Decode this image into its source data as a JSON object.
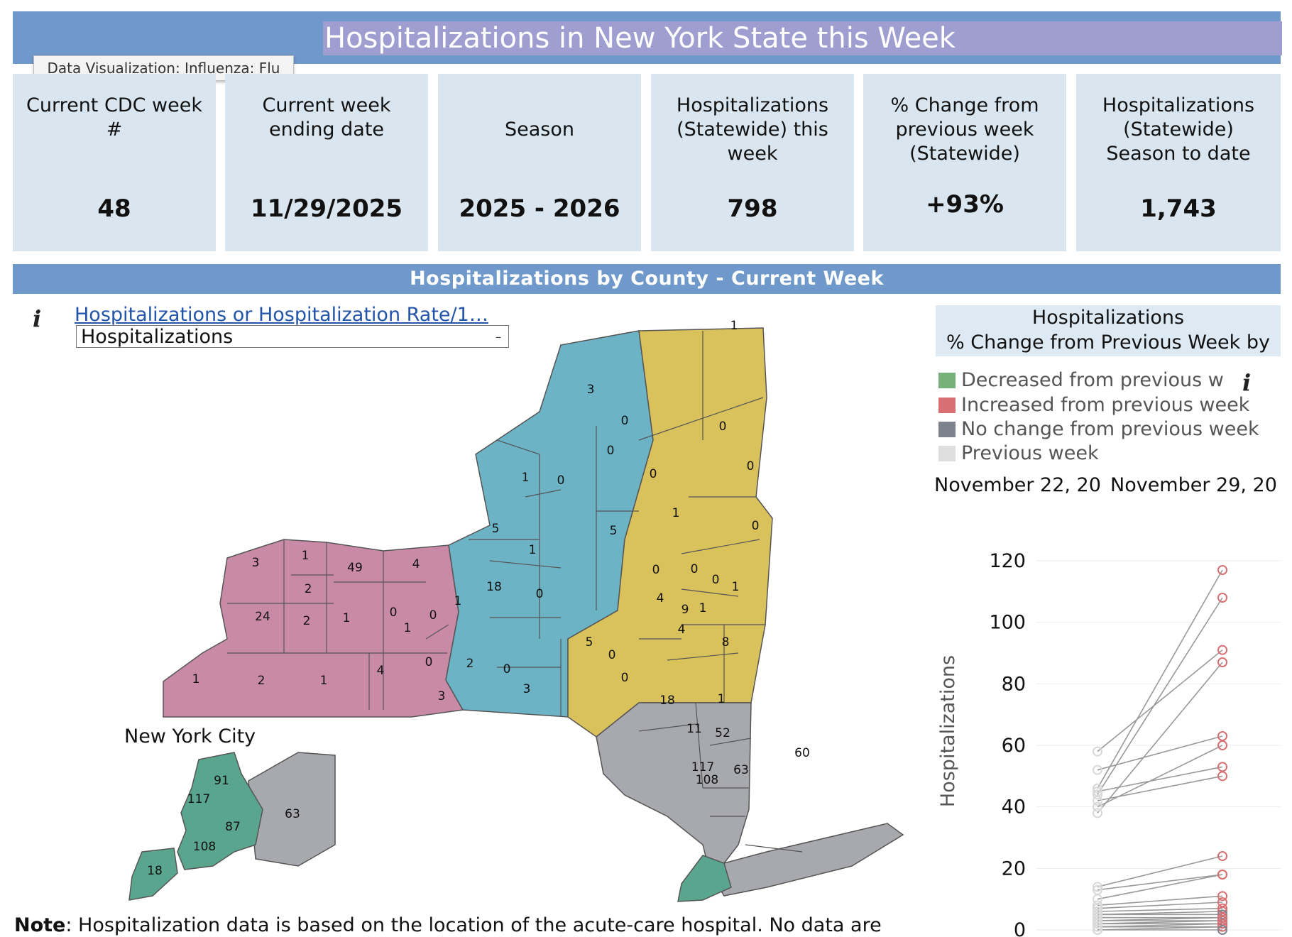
{
  "header": {
    "title": "Hospitalizations in New York State this Week",
    "tooltip": "Data Visualization: Influenza: Flu"
  },
  "cards": [
    {
      "label": "Current CDC week\n#",
      "value": "48"
    },
    {
      "label": "Current week\nending date",
      "value": "11/29/2025"
    },
    {
      "label": "Season",
      "value": "2025 - 2026"
    },
    {
      "label": "Hospitalizations\n(Statewide) this\nweek",
      "value": "798"
    },
    {
      "label": "% Change from\nprevious week\n(Statewide)",
      "value": "+93%"
    },
    {
      "label": "Hospitalizations\n(Statewide)\nSeason to date",
      "value": "1,743"
    }
  ],
  "section_title": "Hospitalizations by County - Current Week",
  "measure_selector": {
    "label": "Hospitalizations or Hospitalization Rate/1…",
    "selected": "Hospitalizations",
    "arrow": "–"
  },
  "map": {
    "nyc_label": "New York City",
    "colors": {
      "western": "#c98aa8",
      "central": "#6cb3c5",
      "eastern": "#d9c25c",
      "downstate": "#a8a9ae",
      "nyc": "#5aa58e"
    },
    "county_values": [
      "3",
      "1",
      "49",
      "4",
      "2",
      "24",
      "2",
      "1",
      "0",
      "0",
      "1",
      "1",
      "2",
      "1",
      "4",
      "0",
      "3",
      "2",
      "1",
      "18",
      "0",
      "0",
      "3",
      "1",
      "5",
      "1",
      "0",
      "3",
      "0",
      "5",
      "0",
      "0",
      "1",
      "0",
      "1",
      "0",
      "0",
      "0",
      "4",
      "5",
      "9",
      "0",
      "1",
      "0",
      "0",
      "1",
      "8",
      "4",
      "0",
      "18",
      "1",
      "11",
      "52",
      "117",
      "108",
      "63",
      "60"
    ],
    "nyc_values": [
      "91",
      "117",
      "87",
      "108",
      "18",
      "63"
    ]
  },
  "legend": {
    "title_line1": "Hospitalizations",
    "title_line2": "% Change from Previous Week by",
    "items": [
      {
        "label": "Decreased from previous w",
        "color": "#78b07a"
      },
      {
        "label": "Increased from previous week",
        "color": "#d86f72"
      },
      {
        "label": "No change from previous week",
        "color": "#7c838c"
      },
      {
        "label": "Previous week",
        "color": "#dedede"
      }
    ]
  },
  "chart_data": {
    "type": "scatter",
    "categories": [
      "November 22, 20",
      "November 29, 20"
    ],
    "ylabel": "Hospitalizations",
    "yticks": [
      "120",
      "100",
      "80",
      "60",
      "40",
      "20",
      "0"
    ],
    "ylim": [
      0,
      125
    ],
    "pairs": [
      [
        46,
        117
      ],
      [
        44,
        108
      ],
      [
        58,
        91
      ],
      [
        38,
        87
      ],
      [
        52,
        63
      ],
      [
        40,
        60
      ],
      [
        45,
        53
      ],
      [
        42,
        50
      ],
      [
        14,
        24
      ],
      [
        13,
        18
      ],
      [
        10,
        18
      ],
      [
        8,
        11
      ],
      [
        7,
        9
      ],
      [
        6,
        7
      ],
      [
        5,
        6
      ],
      [
        5,
        5
      ],
      [
        4,
        4
      ],
      [
        3,
        4
      ],
      [
        3,
        3
      ],
      [
        2,
        3
      ],
      [
        2,
        2
      ],
      [
        1,
        2
      ],
      [
        1,
        1
      ],
      [
        0,
        1
      ],
      [
        0,
        0
      ]
    ]
  },
  "note": {
    "bold": "Note",
    "text": ": Hospitalization data is based on the location of the acute-care hospital. No data are"
  }
}
